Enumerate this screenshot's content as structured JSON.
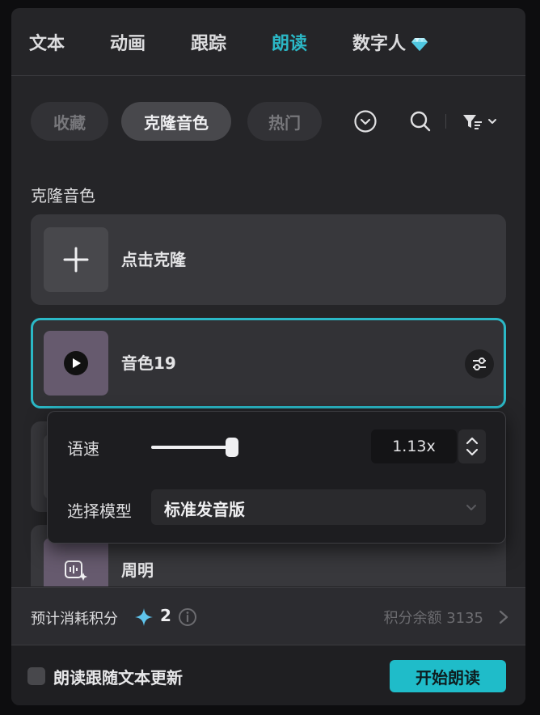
{
  "tabs": [
    {
      "label": "文本",
      "active": false
    },
    {
      "label": "动画",
      "active": false
    },
    {
      "label": "跟踪",
      "active": false
    },
    {
      "label": "朗读",
      "active": true
    },
    {
      "label": "数字人",
      "active": false,
      "icon": "diamond-icon"
    }
  ],
  "filters": {
    "pills": [
      {
        "label": "收藏",
        "active": false
      },
      {
        "label": "克隆音色",
        "active": true
      },
      {
        "label": "热门",
        "active": false
      }
    ],
    "icons": [
      "chevron-down-circle-icon",
      "search-icon",
      "filter-sort-icon"
    ]
  },
  "section": {
    "title": "克隆音色"
  },
  "voices": [
    {
      "label": "点击克隆",
      "icon": "plus-icon"
    },
    {
      "label": "音色19",
      "icon": "play-icon",
      "selected": true
    },
    {
      "label": "周明",
      "icon": "voice-clone-icon"
    }
  ],
  "popover": {
    "speed_label": "语速",
    "speed_value": "1.13x",
    "model_label": "选择模型",
    "model_value": "标准发音版"
  },
  "cost": {
    "label": "预计消耗积分",
    "amount": "2",
    "balance_label": "积分余额",
    "balance_value": "3135"
  },
  "footer": {
    "follow_text_label": "朗读跟随文本更新",
    "start_button": "开始朗读"
  },
  "colors": {
    "accent": "#2bb8c6",
    "button": "#1fbcc9",
    "panel": "#252528"
  }
}
